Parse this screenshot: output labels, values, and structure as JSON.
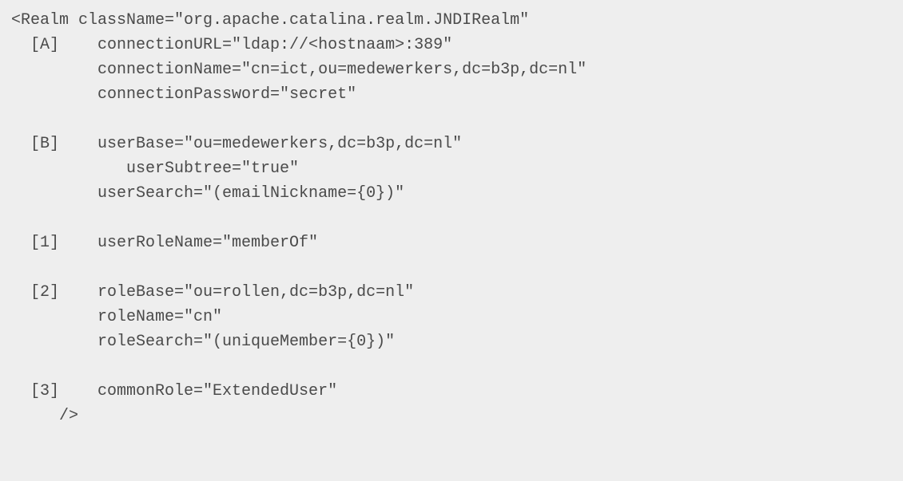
{
  "code": {
    "lines": [
      "<Realm className=\"org.apache.catalina.realm.JNDIRealm\"",
      "  [A]    connectionURL=\"ldap://<hostnaam>:389\"",
      "         connectionName=\"cn=ict,ou=medewerkers,dc=b3p,dc=nl\"",
      "         connectionPassword=\"secret\"",
      "",
      "  [B]    userBase=\"ou=medewerkers,dc=b3p,dc=nl\"",
      "            userSubtree=\"true\"",
      "         userSearch=\"(emailNickname={0})\"",
      "",
      "  [1]    userRoleName=\"memberOf\"",
      "",
      "  [2]    roleBase=\"ou=rollen,dc=b3p,dc=nl\"",
      "         roleName=\"cn\"",
      "         roleSearch=\"(uniqueMember={0})\"",
      "",
      "  [3]    commonRole=\"ExtendedUser\"",
      "     />"
    ]
  }
}
